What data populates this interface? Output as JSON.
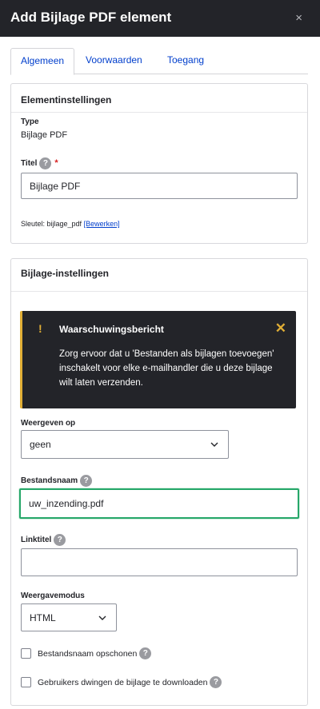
{
  "dialog": {
    "title": "Add Bijlage PDF element",
    "close_icon": "×"
  },
  "tabs": [
    {
      "label": "Algemeen",
      "active": true
    },
    {
      "label": "Voorwaarden",
      "active": false
    },
    {
      "label": "Toegang",
      "active": false
    }
  ],
  "element_settings": {
    "heading": "Elementinstellingen",
    "type_label": "Type",
    "type_value": "Bijlage PDF",
    "title_label": "Titel",
    "title_required_mark": "*",
    "title_value": "Bijlage PDF",
    "key_prefix": "Sleutel: bijlage_pdf",
    "key_edit_link": "[Bewerken]"
  },
  "attachment_settings": {
    "heading": "Bijlage-instellingen",
    "warning": {
      "bang": "!",
      "title": "Waarschuwingsbericht",
      "close": "✕",
      "body": "Zorg ervoor dat u 'Bestanden als bijlagen toevoegen' inschakelt voor elke e-mailhandler die u deze bijlage wilt laten verzenden."
    },
    "display_on_label": "Weergeven op",
    "display_on_value": "geen",
    "filename_label": "Bestandsnaam",
    "filename_value": "uw_inzending.pdf",
    "link_title_label": "Linktitel",
    "link_title_value": "",
    "display_mode_label": "Weergavemodus",
    "display_mode_value": "HTML",
    "sanitize_label": "Bestandsnaam opschonen",
    "force_download_label": "Gebruikers dwingen de bijlage te downloaden"
  },
  "help_glyph": "?",
  "colors": {
    "header_bg": "#232429",
    "link": "#003ecc",
    "warning_accent": "#e0ae35",
    "focus_border": "#26a769",
    "required": "#d72222"
  }
}
